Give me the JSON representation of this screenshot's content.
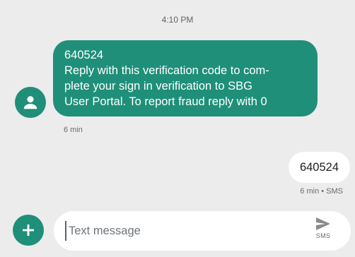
{
  "thread": {
    "timestamp": "4:10 PM",
    "incoming": {
      "lines": [
        "640524",
        "Reply with this verification code to com-",
        "plete your sign in verification to SBG",
        "User Portal. To report fraud reply with 0"
      ],
      "meta": "6 min"
    },
    "outgoing": {
      "text": "640524",
      "meta": "6 min • SMS"
    }
  },
  "compose": {
    "placeholder": "Text message",
    "value": "",
    "send_label": "SMS"
  },
  "icons": {
    "avatar": "person-icon",
    "add": "plus-icon",
    "send": "send-icon"
  },
  "colors": {
    "accent": "#1f8f7a",
    "background": "#ececec",
    "bubble_out": "#ffffff",
    "meta_text": "#6b6b6b"
  }
}
